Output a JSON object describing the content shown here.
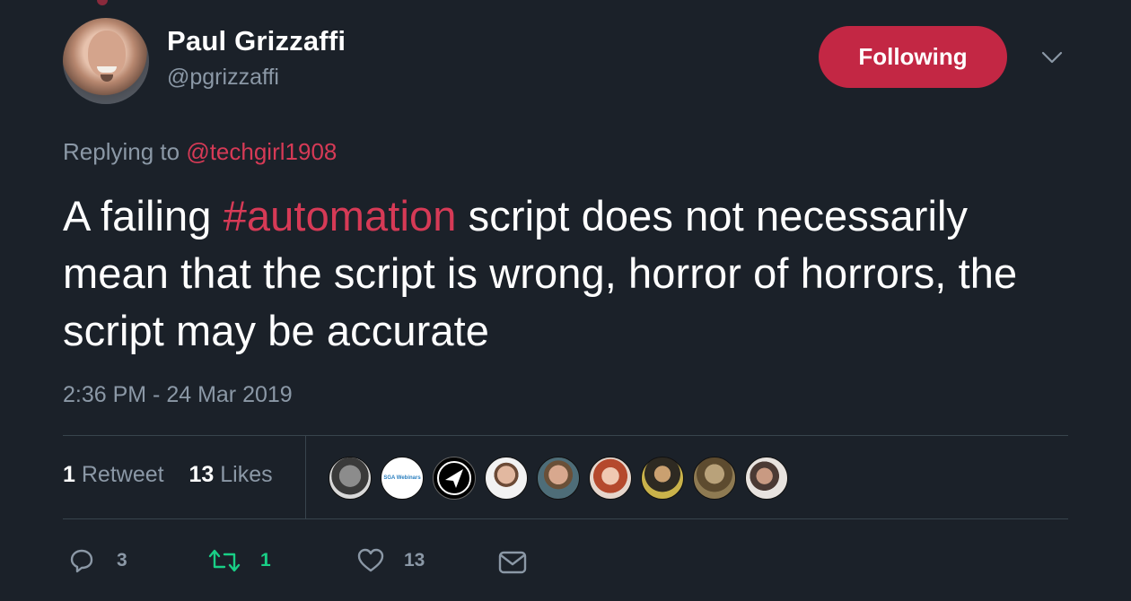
{
  "author": {
    "display_name": "Paul Grizzaffi",
    "handle": "@pgrizzaffi",
    "avatar_icon": "user-avatar"
  },
  "follow_button": {
    "label": "Following",
    "color": "#c32744"
  },
  "menu_icon": "chevron-down-icon",
  "reply": {
    "prefix": "Replying to",
    "mention": "@techgirl1908"
  },
  "tweet": {
    "text_before": "A failing ",
    "hashtag": "#automation",
    "text_after": " script does not necessarily mean that the script is wrong, horror of horrors, the script may be accurate"
  },
  "timestamp": "2:36 PM - 24 Mar 2019",
  "stats": {
    "retweets_count": "1",
    "retweets_label": "Retweet",
    "likes_count": "13",
    "likes_label": "Likes"
  },
  "likers_label": "SGA Webinars",
  "actions": {
    "reply_count": "3",
    "retweet_count": "1",
    "like_count": "13"
  },
  "colors": {
    "background": "#1b2129",
    "accent": "#d63a56",
    "muted": "#8b98a6",
    "retweet": "#19cf86"
  }
}
